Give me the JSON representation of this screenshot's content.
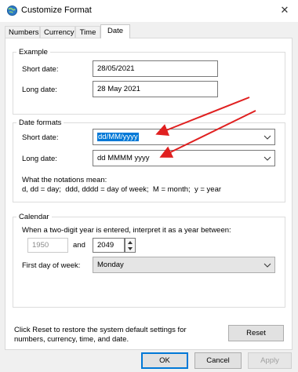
{
  "window": {
    "title": "Customize Format",
    "close_glyph": "✕"
  },
  "tabs": [
    {
      "label": "Numbers"
    },
    {
      "label": "Currency"
    },
    {
      "label": "Time"
    },
    {
      "label": "Date"
    }
  ],
  "example": {
    "group_title": "Example",
    "short_label": "Short date:",
    "short_value": "28/05/2021",
    "long_label": "Long date:",
    "long_value": "28 May 2021"
  },
  "date_formats": {
    "group_title": "Date formats",
    "short_label": "Short date:",
    "short_value": "dd/MM/yyyy",
    "long_label": "Long date:",
    "long_value": "dd MMMM yyyy",
    "notation_heading": "What the notations mean:",
    "notation_text": "d, dd = day;  ddd, dddd = day of week;  M = month;  y = year"
  },
  "calendar": {
    "group_title": "Calendar",
    "two_digit_text": "When a two-digit year is entered, interpret it as a year between:",
    "year_from": "1950",
    "and_label": "and",
    "year_to": "2049",
    "first_day_label": "First day of week:",
    "first_day_value": "Monday"
  },
  "footer": {
    "reset_text": "Click Reset to restore the system default settings for numbers, currency, time, and date.",
    "reset_button": "Reset"
  },
  "buttons": {
    "ok": "OK",
    "cancel": "Cancel",
    "apply": "Apply"
  },
  "colors": {
    "accent": "#0078d7",
    "arrow": "#e02020"
  }
}
